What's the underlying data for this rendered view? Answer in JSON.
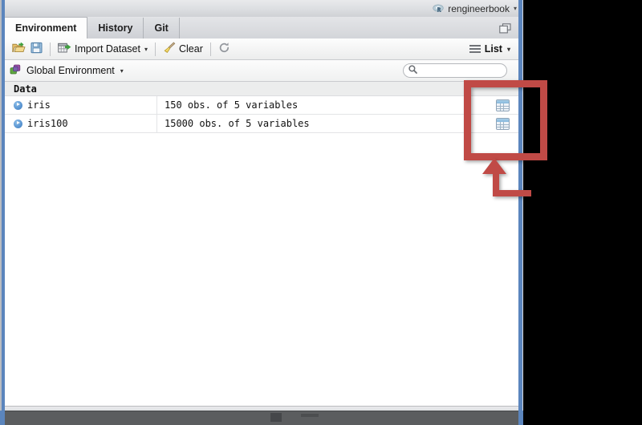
{
  "window": {
    "title": "rengineerbook",
    "title_icon": "r-logo-icon"
  },
  "tabs": [
    {
      "label": "Environment",
      "active": true
    },
    {
      "label": "History",
      "active": false
    },
    {
      "label": "Git",
      "active": false
    }
  ],
  "tabbar": {
    "maximize_icon": "maximize-panes-icon"
  },
  "toolbar": {
    "open_icon": "open-folder-icon",
    "save_icon": "save-floppy-icon",
    "import_label": "Import Dataset",
    "import_icon": "import-dataset-icon",
    "import_caret": "▾",
    "clear_label": "Clear",
    "clear_icon": "broom-icon",
    "refresh_icon": "refresh-icon",
    "list_label": "List",
    "list_caret": "▾",
    "list_icon": "list-lines-icon"
  },
  "envrow": {
    "environment_label": "Global Environment",
    "environment_icon": "cubes-icon",
    "environment_caret": "▾",
    "search_icon": "search-icon",
    "search_value": "",
    "search_placeholder": ""
  },
  "grid": {
    "section_label": "Data",
    "rows": [
      {
        "name": "iris",
        "description": "150 obs. of 5 variables",
        "expand_icon": "expand-arrow-icon",
        "action_icon": "view-table-icon"
      },
      {
        "name": "iris100",
        "description": "15000 obs. of 5 variables",
        "expand_icon": "expand-arrow-icon",
        "action_icon": "view-table-icon"
      }
    ]
  },
  "annotation": {
    "highlight_color": "#c04a46",
    "rect_name": "highlight-rectangle",
    "arrow_name": "callout-arrow"
  }
}
